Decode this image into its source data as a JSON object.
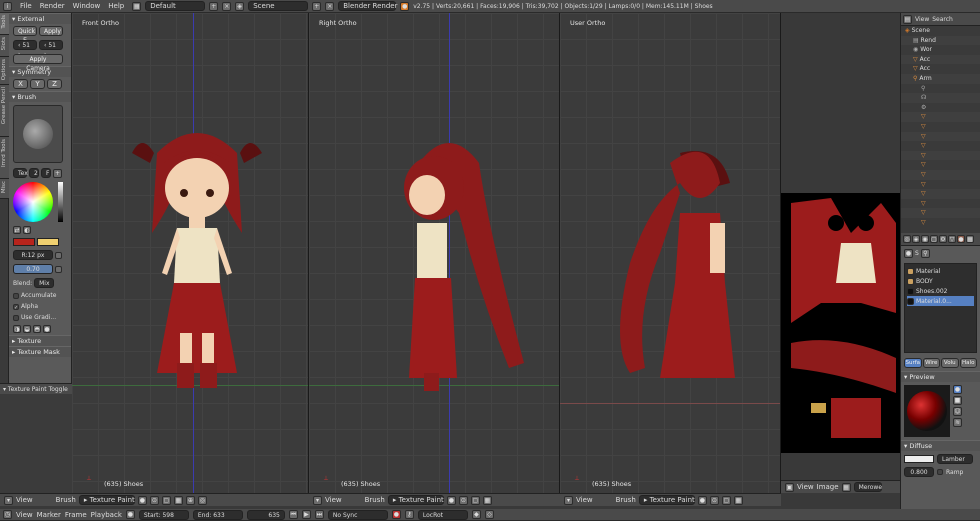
{
  "menu": [
    "File",
    "Render",
    "Window",
    "Help"
  ],
  "screen_layout": "Default",
  "scene": "Scene",
  "engine": "Blender Render",
  "stats": "v2.75 | Verts:20,661 | Faces:19,906 | Tris:39,702 | Objects:1/29 | Lamps:0/0 | Mem:145.11M | Shoes",
  "tool_tabs": [
    "Tools",
    "Slots",
    "Options",
    "Grease Pencil",
    "Imrd Tools",
    "Misc"
  ],
  "tools": {
    "external_title": "External",
    "quick_edit": "Quick E",
    "apply": "Apply",
    "size_x": "51",
    "size_y": "51",
    "apply_camera": "Apply Camera",
    "symmetry_title": "Symmetry",
    "sym_axes": [
      "X",
      "Y",
      "Z"
    ],
    "brush_title": "Brush",
    "tex_label": "Tex",
    "tex_num": "2",
    "tex_f": "F",
    "radius": "R:12 px",
    "strength": "0.70",
    "blend_label": "Blend:",
    "blend_value": "Mix",
    "accumulate": "Accumulate",
    "alpha": "Alpha",
    "use_gradient": "Use Gradi...",
    "texture_panel": "Texture",
    "texture_mask_panel": "Texture Mask",
    "texture_paint_toggle": "Texture Paint Toggle"
  },
  "viewports": [
    {
      "label": "Front Ortho",
      "object": "(635) Shoes"
    },
    {
      "label": "Right Ortho",
      "object": "(635) Shoes"
    },
    {
      "label": "User Ortho",
      "object": "(635) Shoes"
    }
  ],
  "view_header": {
    "view": "View",
    "brush": "Brush",
    "mode": "Texture Paint"
  },
  "uv_header": {
    "view": "View",
    "image": "Image",
    "name": "Merowe"
  },
  "outliner": {
    "header_view": "View",
    "header_search": "Search",
    "items": [
      "Scene",
      "Rend",
      "Wor",
      "Acc",
      "Acc",
      "Arm",
      "",
      "",
      "",
      "",
      "",
      "",
      "",
      "",
      "",
      "",
      "",
      "",
      "",
      "",
      ""
    ]
  },
  "properties": {
    "tab_s": "S",
    "materials": [
      "Material",
      "BODY",
      "Shoes.002",
      "Material.0..."
    ],
    "shader_tabs": [
      "Surfa",
      "Wire",
      "Volu",
      "Halo"
    ],
    "preview_title": "Preview",
    "diffuse_title": "Diffuse",
    "diffuse_shader": "Lamber",
    "intensity": "0.800",
    "ramp": "Ramp"
  },
  "timeline": {
    "menu": [
      "View",
      "Marker",
      "Frame",
      "Playback"
    ],
    "start_label": "Start:",
    "start": "598",
    "end_label": "End:",
    "end": "633",
    "current": "635",
    "sync": "No Sync",
    "keying": "LocRot"
  },
  "colors": {
    "hair": "#8e1b1b",
    "dress": "#9c1c1c",
    "skin": "#f3d2b2",
    "cream": "#eee3c4",
    "gold": "#c9a24a",
    "primary": "#b8241c",
    "secondary": "#f0d070"
  }
}
